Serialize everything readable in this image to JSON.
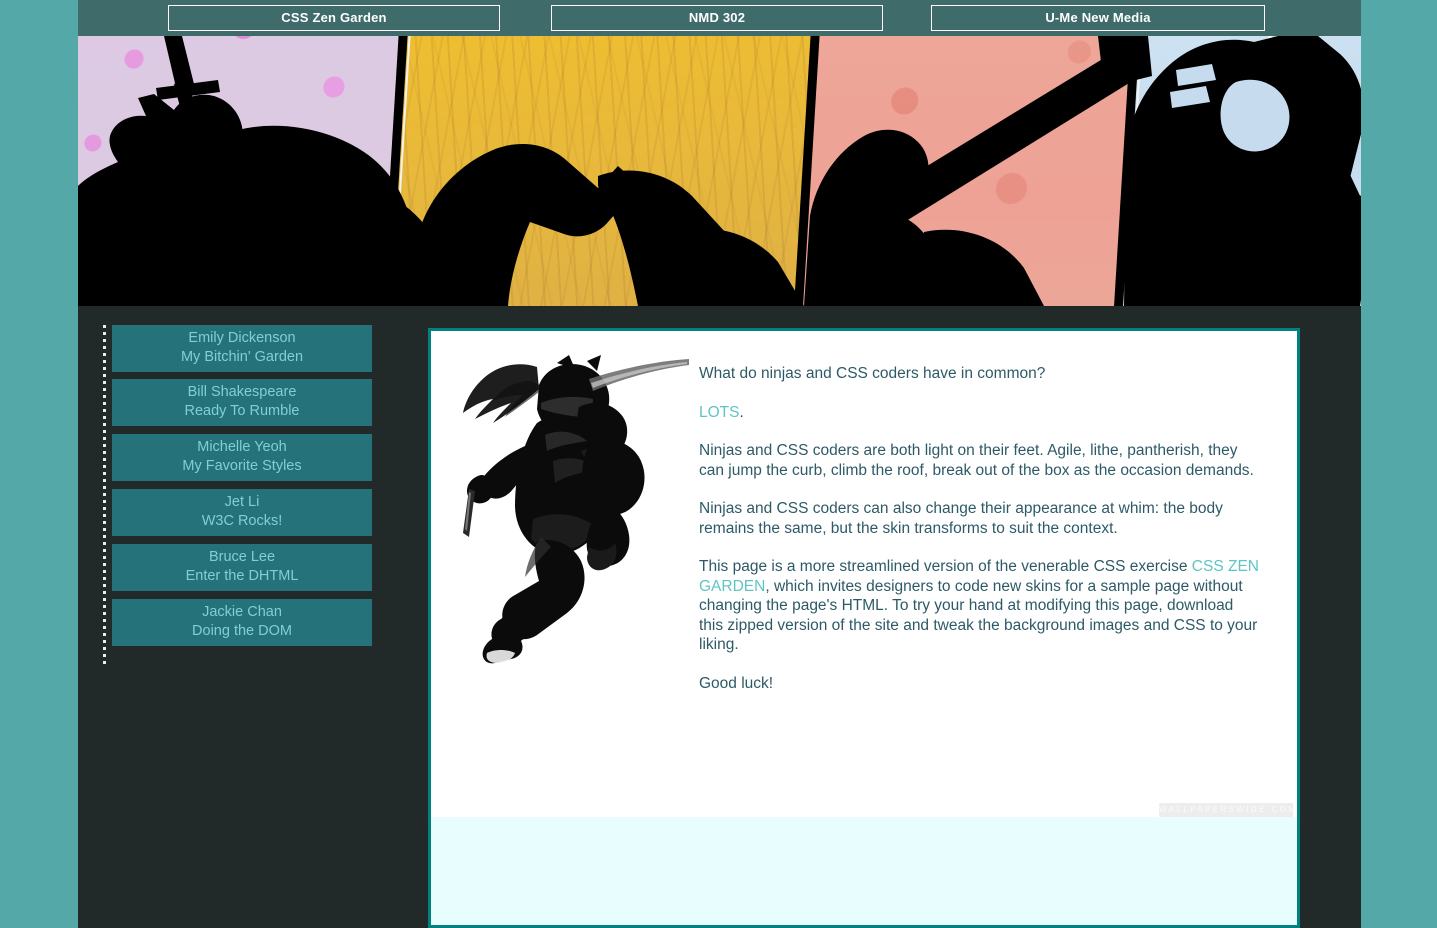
{
  "nav": {
    "items": [
      {
        "label": "CSS Zen Garden"
      },
      {
        "label": "NMD 302"
      },
      {
        "label": "U-Me New Media"
      }
    ]
  },
  "banner": {
    "alt": "four-panel ninja silhouette banner",
    "panels": [
      {
        "name": "sakura-panel",
        "color": "#ddc9e4"
      },
      {
        "name": "gold-grass-panel",
        "color": "#f0bf2e"
      },
      {
        "name": "coral-panel",
        "color": "#eda798"
      },
      {
        "name": "snow-panel",
        "color": "#cfe3f2"
      }
    ]
  },
  "sidebar": {
    "items": [
      {
        "name": "Emily Dickenson",
        "subtitle": "My Bitchin' Garden"
      },
      {
        "name": "Bill Shakespeare",
        "subtitle": "Ready To Rumble"
      },
      {
        "name": "Michelle Yeoh",
        "subtitle": "My Favorite Styles"
      },
      {
        "name": "Jet Li",
        "subtitle": "W3C Rocks!"
      },
      {
        "name": "Bruce Lee",
        "subtitle": "Enter the DHTML"
      },
      {
        "name": "Jackie Chan",
        "subtitle": "Doing the DOM"
      }
    ]
  },
  "content": {
    "ninja_alt": "leaping ninja with katana",
    "paragraphs": {
      "p1": "What do ninjas and CSS coders have in common?",
      "p2_link": "LOTS",
      "p2_after": ".",
      "p3": "Ninjas and CSS coders are both light on their feet. Agile, lithe, pantherish, they can jump the curb, climb the roof, break out of the box as the occasion demands.",
      "p4": "Ninjas and CSS coders can also change their appearance at whim: the body remains the same, but the skin transforms to suit the context.",
      "p5_before": "This page is a more streamlined version of the venerable CSS exercise ",
      "p5_link": "CSS ZEN GARDEN",
      "p5_after": ", which invites designers to code new skins for a sample page without changing the page's HTML. To try your hand at modifying this page, download this zipped version of the site and tweak the background images and CSS to your liking.",
      "p6": "Good luck!"
    },
    "watermark": "WALLPAPERSWIDE.COM"
  },
  "colors": {
    "page_background": "#55a8a8",
    "nav_background": "#3f6b6b",
    "dark_panel": "#212a29",
    "sidebar_button": "#26727a",
    "sidebar_text": "#7ed0d4",
    "content_border": "#038080",
    "body_text": "#2d5a66",
    "link": "#5ec4c4",
    "footer_band": "#e8fdfd"
  }
}
